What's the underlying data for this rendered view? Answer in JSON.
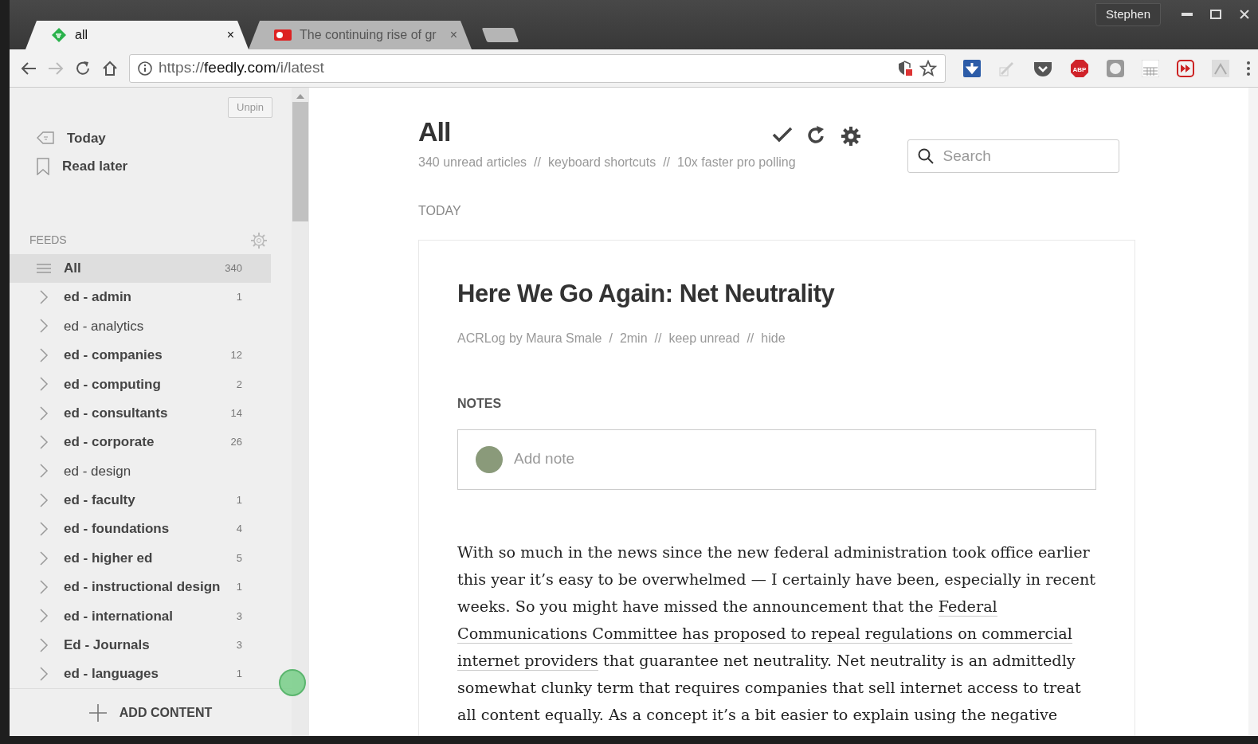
{
  "browser": {
    "profile": "Stephen",
    "tabs": [
      {
        "title": "all",
        "selected": true,
        "close": "×"
      },
      {
        "title": "The continuing rise of gr",
        "selected": false,
        "close": "×"
      }
    ],
    "adblock_label": "ABP",
    "url": {
      "scheme": "https://",
      "host": "feedly.com",
      "path": "/i/latest"
    }
  },
  "sidebar": {
    "unpin": "Unpin",
    "nav": [
      {
        "kind": "today",
        "label": "Today"
      },
      {
        "kind": "bookmark",
        "label": "Read later"
      }
    ],
    "feeds_header": "FEEDS",
    "feeds": [
      {
        "kind": "all",
        "label": "All",
        "count": "340",
        "selected": true,
        "unread": true
      },
      {
        "kind": "category",
        "label": "ed - admin",
        "count": "1",
        "selected": false,
        "unread": true
      },
      {
        "kind": "category",
        "label": "ed - analytics",
        "selected": false,
        "unread": false
      },
      {
        "kind": "category",
        "label": "ed - companies",
        "count": "12",
        "selected": false,
        "unread": true
      },
      {
        "kind": "category",
        "label": "ed - computing",
        "count": "2",
        "selected": false,
        "unread": true
      },
      {
        "kind": "category",
        "label": "ed - consultants",
        "count": "14",
        "selected": false,
        "unread": true
      },
      {
        "kind": "category",
        "label": "ed - corporate",
        "count": "26",
        "selected": false,
        "unread": true
      },
      {
        "kind": "category",
        "label": "ed - design",
        "selected": false,
        "unread": false
      },
      {
        "kind": "category",
        "label": "ed - faculty",
        "count": "1",
        "selected": false,
        "unread": true
      },
      {
        "kind": "category",
        "label": "ed - foundations",
        "count": "4",
        "selected": false,
        "unread": true
      },
      {
        "kind": "category",
        "label": "ed - higher ed",
        "count": "5",
        "selected": false,
        "unread": true
      },
      {
        "kind": "category",
        "label": "ed - instructional design",
        "count": "1",
        "selected": false,
        "unread": true
      },
      {
        "kind": "category",
        "label": "ed - international",
        "count": "3",
        "selected": false,
        "unread": true
      },
      {
        "kind": "category",
        "label": "Ed - Journals",
        "count": "3",
        "selected": false,
        "unread": true
      },
      {
        "kind": "category",
        "label": "ed - languages",
        "count": "1",
        "selected": false,
        "unread": true
      }
    ],
    "add_content": "ADD CONTENT"
  },
  "main": {
    "title": "All",
    "links": [
      "340 unread articles",
      "keyboard shortcuts",
      "10x faster pro polling"
    ],
    "separator": "//",
    "search": {
      "placeholder": "Search"
    },
    "section": "TODAY",
    "article": {
      "title": "Here We Go Again: Net Neutrality",
      "meta": [
        {
          "text": "ACRLog by Maura Smale",
          "sep": "/"
        },
        {
          "text": "2min",
          "sep": "//"
        },
        {
          "text": "keep unread",
          "sep": "//"
        },
        {
          "text": "hide"
        }
      ],
      "notes_label": "NOTES",
      "note_placeholder": "Add note",
      "lines": [
        [
          {
            "text": "With so much in the news since the new federal administration took office earlier",
            "link": false
          }
        ],
        [
          {
            "text": "this year it’s easy to be overwhelmed — I certainly have been, especially in recent",
            "link": false
          }
        ],
        [
          {
            "text": "weeks. So you might have missed the announcement that the",
            "link": false
          },
          {
            "text": "Federal",
            "link": true
          }
        ],
        [
          {
            "text": "Communications Committee has proposed to repeal regulations on commercial",
            "link": true
          }
        ],
        [
          {
            "text": "internet providers",
            "link": true
          },
          {
            "text": "that guarantee net neutrality. Net neutrality is an admittedly",
            "link": false
          }
        ],
        [
          {
            "text": "somewhat clunky term that requires companies that sell internet access to treat",
            "link": false
          }
        ],
        [
          {
            "text": "all content equally. As a concept it’s a bit easier to explain using the negative",
            "link": false
          }
        ]
      ]
    }
  }
}
